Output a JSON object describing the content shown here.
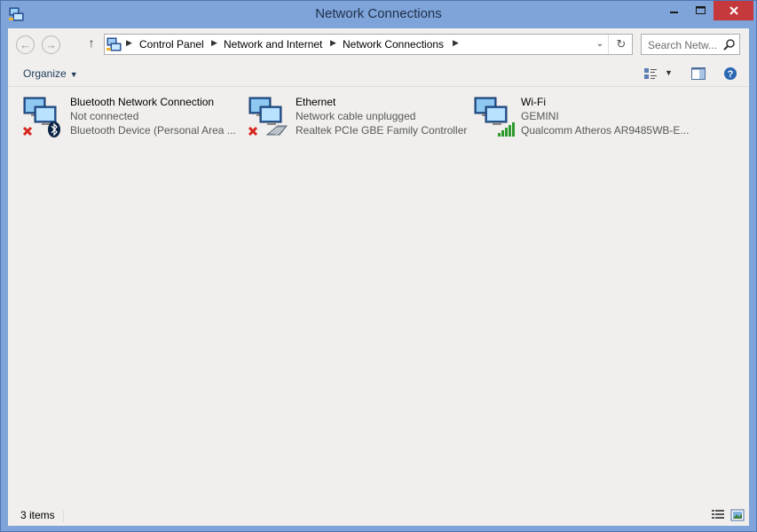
{
  "window": {
    "title": "Network Connections",
    "minimize_label": "—",
    "maximize_label": "☐",
    "close_label": "✕"
  },
  "navigation": {
    "back_icon": "back-arrow-icon",
    "forward_icon": "forward-arrow-icon",
    "up_icon": "up-arrow-icon",
    "up_glyph": "↑",
    "back_glyph": "←",
    "forward_glyph": "→"
  },
  "address": {
    "crumbs": [
      "Control Panel",
      "Network and Internet",
      "Network Connections"
    ],
    "separator": "▶",
    "dropdown_glyph": "⌄",
    "refresh_glyph": "↻"
  },
  "search": {
    "placeholder": "Search Netw..."
  },
  "toolbar": {
    "organize_label": "Organize",
    "organize_caret": "▼",
    "view_caret": "▼"
  },
  "connections": [
    {
      "name": "Bluetooth Network Connection",
      "status": "Not connected",
      "device": "Bluetooth Device (Personal Area ...",
      "overlay": "bluetooth",
      "error": true
    },
    {
      "name": "Ethernet",
      "status": "Network cable unplugged",
      "device": "Realtek PCIe GBE Family Controller",
      "overlay": "cable",
      "error": true
    },
    {
      "name": "Wi-Fi",
      "status": "GEMINI",
      "device": "Qualcomm Atheros AR9485WB-E...",
      "overlay": "signal",
      "error": false
    }
  ],
  "statusbar": {
    "item_count": "3 items"
  },
  "colors": {
    "titlebar": "#7ea4d9",
    "close_button": "#c5383b",
    "content_bg": "#f0efed",
    "error_red": "#d6261d",
    "signal_green": "#2f9b2f"
  }
}
